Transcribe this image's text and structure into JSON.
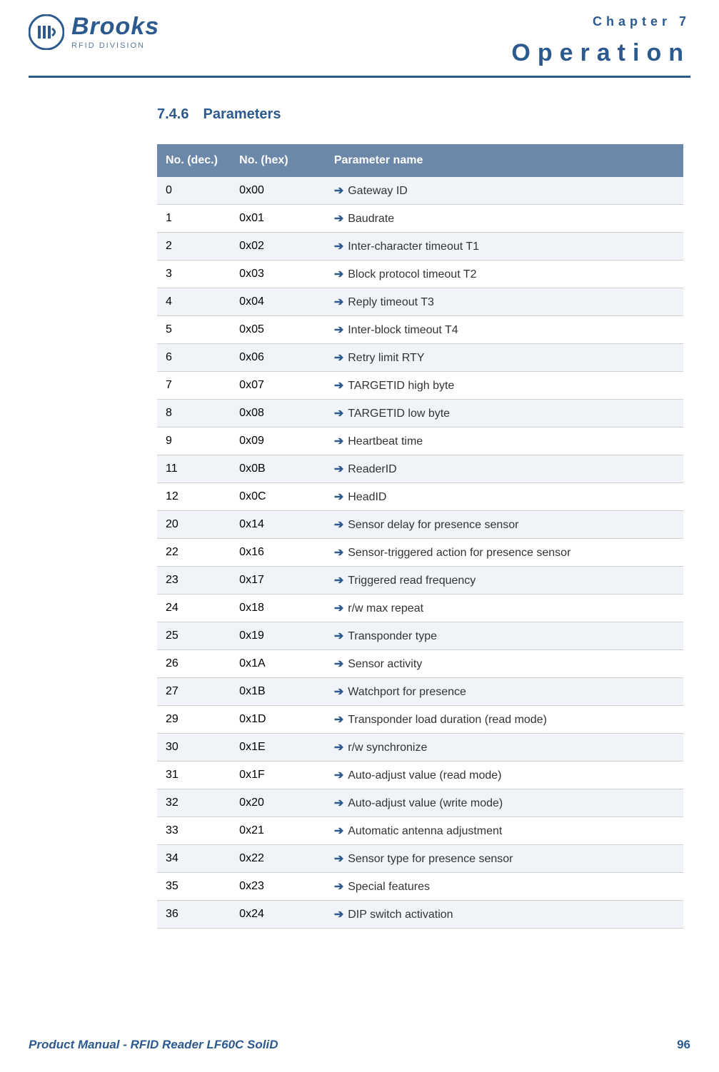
{
  "header": {
    "brand": "Brooks",
    "division": "RFID DIVISION",
    "chapter_label": "Chapter 7",
    "chapter_title": "Operation"
  },
  "section": {
    "number": "7.4.6",
    "title": "Parameters"
  },
  "table": {
    "headers": {
      "dec": "No. (dec.)",
      "hex": "No. (hex)",
      "name": "Parameter name"
    },
    "rows": [
      {
        "dec": "0",
        "hex": "0x00",
        "name": "Gateway ID"
      },
      {
        "dec": "1",
        "hex": "0x01",
        "name": "Baudrate"
      },
      {
        "dec": "2",
        "hex": "0x02",
        "name": "Inter-character timeout T1"
      },
      {
        "dec": "3",
        "hex": "0x03",
        "name": "Block protocol timeout T2"
      },
      {
        "dec": "4",
        "hex": "0x04",
        "name": "Reply timeout T3"
      },
      {
        "dec": "5",
        "hex": "0x05",
        "name": "Inter-block timeout T4"
      },
      {
        "dec": "6",
        "hex": "0x06",
        "name": "Retry limit RTY"
      },
      {
        "dec": "7",
        "hex": "0x07",
        "name": "TARGETID high byte"
      },
      {
        "dec": "8",
        "hex": "0x08",
        "name": "TARGETID low byte"
      },
      {
        "dec": "9",
        "hex": "0x09",
        "name": "Heartbeat time"
      },
      {
        "dec": "11",
        "hex": "0x0B",
        "name": "ReaderID"
      },
      {
        "dec": "12",
        "hex": "0x0C",
        "name": "HeadID"
      },
      {
        "dec": "20",
        "hex": "0x14",
        "name": "Sensor delay for presence sensor"
      },
      {
        "dec": "22",
        "hex": "0x16",
        "name": "Sensor-triggered action for presence sensor"
      },
      {
        "dec": "23",
        "hex": "0x17",
        "name": "Triggered read frequency"
      },
      {
        "dec": "24",
        "hex": "0x18",
        "name": "r/w max repeat"
      },
      {
        "dec": "25",
        "hex": "0x19",
        "name": "Transponder type"
      },
      {
        "dec": "26",
        "hex": "0x1A",
        "name": "Sensor activity"
      },
      {
        "dec": "27",
        "hex": "0x1B",
        "name": "Watchport for presence"
      },
      {
        "dec": "29",
        "hex": "0x1D",
        "name": "Transponder load duration (read mode)"
      },
      {
        "dec": "30",
        "hex": "0x1E",
        "name": "r/w synchronize"
      },
      {
        "dec": "31",
        "hex": "0x1F",
        "name": "Auto-adjust value (read mode)"
      },
      {
        "dec": "32",
        "hex": "0x20",
        "name": "Auto-adjust value (write mode)"
      },
      {
        "dec": "33",
        "hex": "0x21",
        "name": "Automatic antenna adjustment"
      },
      {
        "dec": "34",
        "hex": "0x22",
        "name": "Sensor type for presence sensor"
      },
      {
        "dec": "35",
        "hex": "0x23",
        "name": "Special features"
      },
      {
        "dec": "36",
        "hex": "0x24",
        "name": "DIP switch activation"
      }
    ]
  },
  "footer": {
    "left": "Product Manual - RFID Reader LF60C SoliD",
    "right": "96"
  }
}
